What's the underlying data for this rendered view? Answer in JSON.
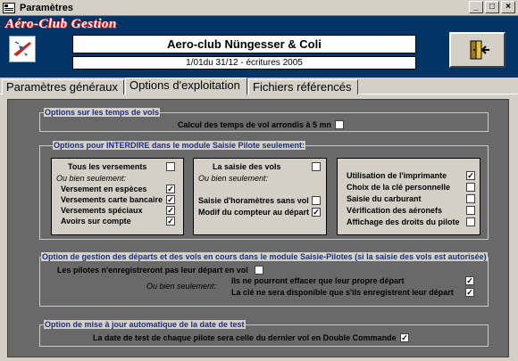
{
  "window": {
    "title": "Paramètres"
  },
  "header": {
    "app_title": "Aéro-Club Gestion",
    "club_name": "Aero-club Nüngesser & Coli",
    "period": "1/01du 31/12 - écritures 2005"
  },
  "tabs": [
    {
      "label": "Paramètres généraux"
    },
    {
      "label": "Options d'exploitation"
    },
    {
      "label": "Fichiers référencés"
    }
  ],
  "active_tab": "Options d'exploitation",
  "vol_times": {
    "title": "Options sur les temps de vols",
    "round_label": "Calcul des temps de vol arrondis à 5 mn",
    "round_checked": false
  },
  "interdire": {
    "title": "Options pour INTERDIRE dans le module Saisie Pilote seulement:",
    "box1": {
      "all_label": "Tous les versements",
      "all_checked": false,
      "or_only": "Ou bien seulement:",
      "items": [
        {
          "label": "Versement en espèces",
          "checked": true
        },
        {
          "label": "Versements carte bancaire",
          "checked": true
        },
        {
          "label": "Versements spéciaux",
          "checked": true
        },
        {
          "label": "Avoirs sur compte",
          "checked": true
        }
      ]
    },
    "box2": {
      "all_label": "La saisie des vols",
      "all_checked": false,
      "or_only": "Ou bien seulement:",
      "items": [
        {
          "label": "Saisie d'horamètres sans vol",
          "checked": false
        },
        {
          "label": "Modif du compteur au départ",
          "checked": true
        }
      ]
    },
    "box3": {
      "items": [
        {
          "label": "Utilisation de l'imprimante",
          "checked": true
        },
        {
          "label": "Choix de la clé personnelle",
          "checked": false
        },
        {
          "label": "Saisie du carburant",
          "checked": false
        },
        {
          "label": "Vérification des aéronefs",
          "checked": false
        },
        {
          "label": "Affichage des droits du pilote",
          "checked": false
        }
      ]
    }
  },
  "departs": {
    "title": "Option de gestion des départs et des vols en cours dans le module Saisie-Pilotes (si la saisie des vols est autorisée)",
    "no_record_label": "Les pilotes n'enregistreront pas leur départ en vol",
    "no_record_checked": false,
    "or_only": "Ou bien seulement:",
    "only_own_label": "Ils ne pourront effacer que leur propre départ",
    "only_own_checked": true,
    "key_label": "La clé ne sera disponible que s'ils enregistrent leur départ",
    "key_checked": true
  },
  "test_date": {
    "title": "Option de mise à jour automatique de la date de test",
    "label": "La date de test de chaque pilote sera celle du dernier vol en Double Commande",
    "checked": true
  },
  "colors": {
    "header_bg": "#003366",
    "panel_bg": "#696969",
    "group_label": "#1c2f7a"
  }
}
